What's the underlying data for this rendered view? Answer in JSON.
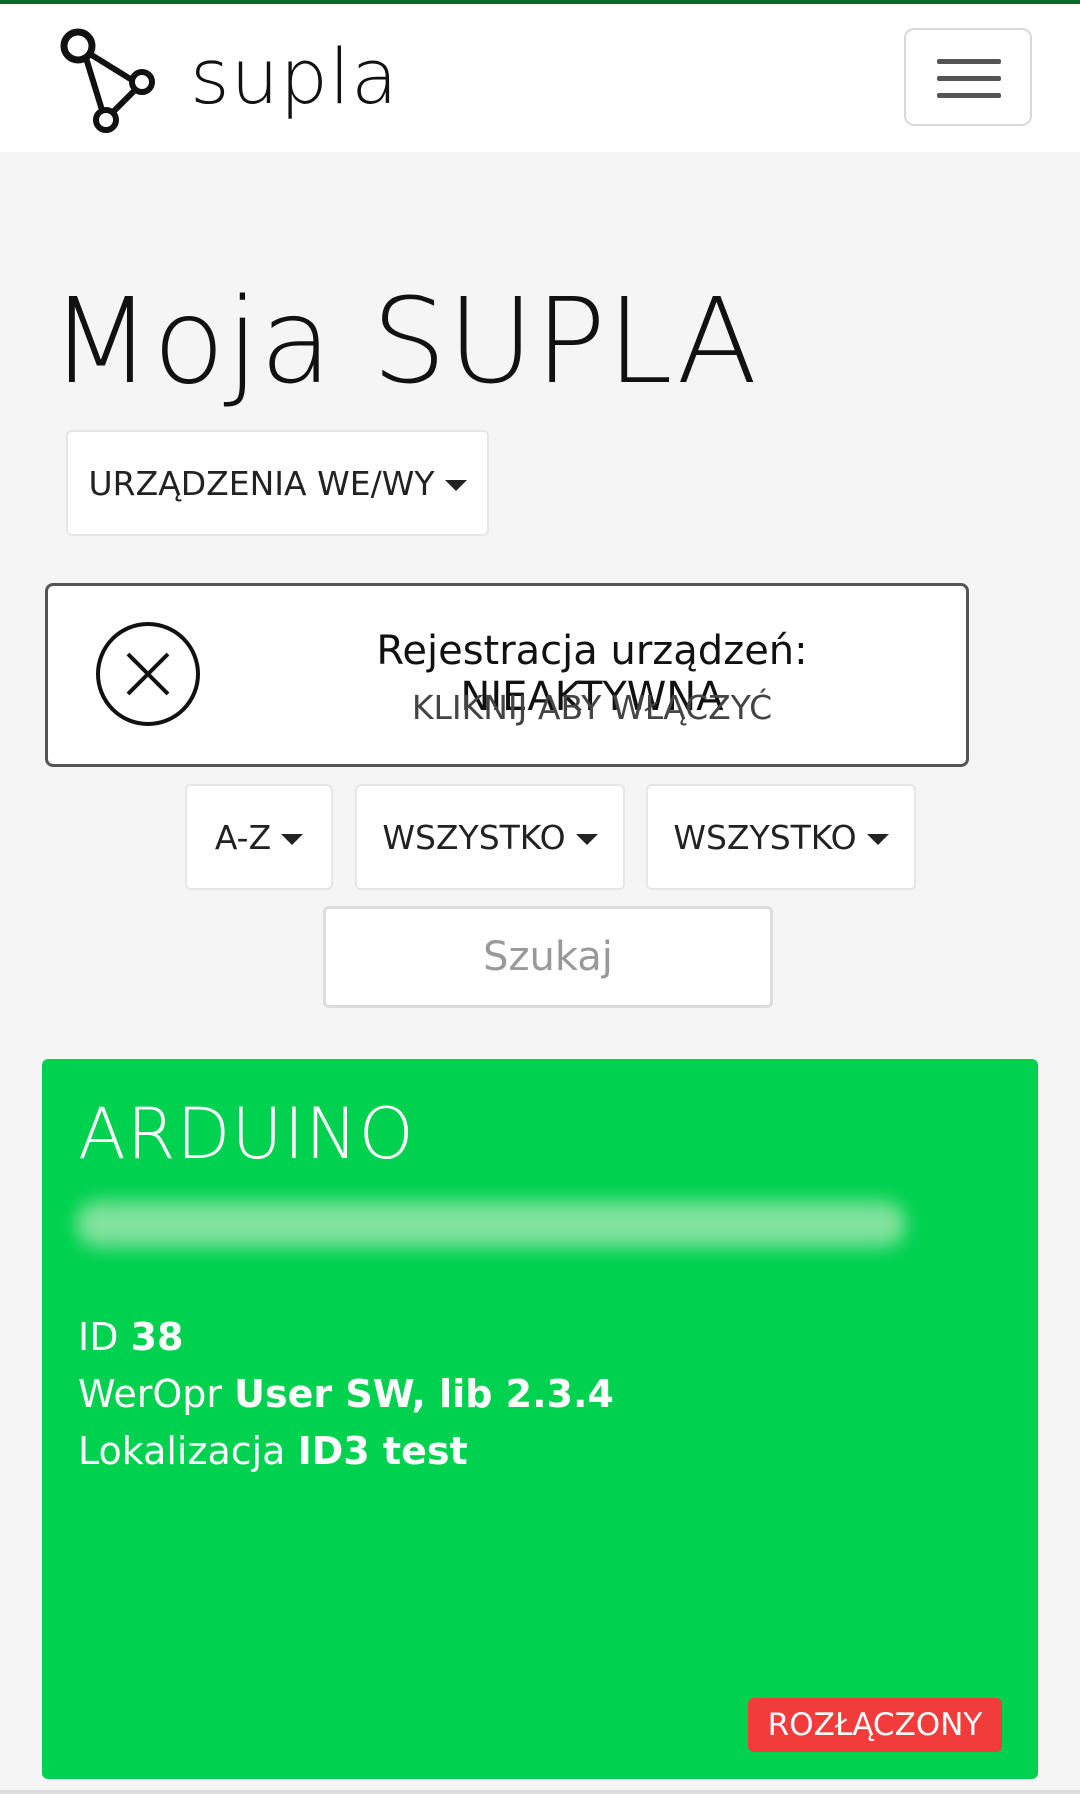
{
  "brand": {
    "name": "supla"
  },
  "page": {
    "title": "Moja SUPLA"
  },
  "nav": {
    "section_dropdown": "URZĄDZENIA WE/WY"
  },
  "registration": {
    "title": "Rejestracja urządzeń: NIEAKTYWNA",
    "action": "KLIKNIJ ABY WŁĄCZYĆ"
  },
  "filters": {
    "sort": "A-Z",
    "state": "WSZYSTKO",
    "type": "WSZYSTKO"
  },
  "search": {
    "placeholder": "Szukaj"
  },
  "device": {
    "name": "ARDUINO",
    "id_label": "ID",
    "id_value": "38",
    "firmware_label": "WerOpr",
    "firmware_value": "User SW, lib 2.3.4",
    "location_label": "Lokalizacja",
    "location_value": "ID3 test",
    "status": "ROZŁĄCZONY"
  },
  "colors": {
    "card_bg": "#00d14f",
    "status_bg": "#f23b3b",
    "accent_topline": "#0c6b2c"
  },
  "icons": [
    "supla-logo-icon",
    "menu-icon",
    "close-circle-icon",
    "caret-down-icon"
  ]
}
